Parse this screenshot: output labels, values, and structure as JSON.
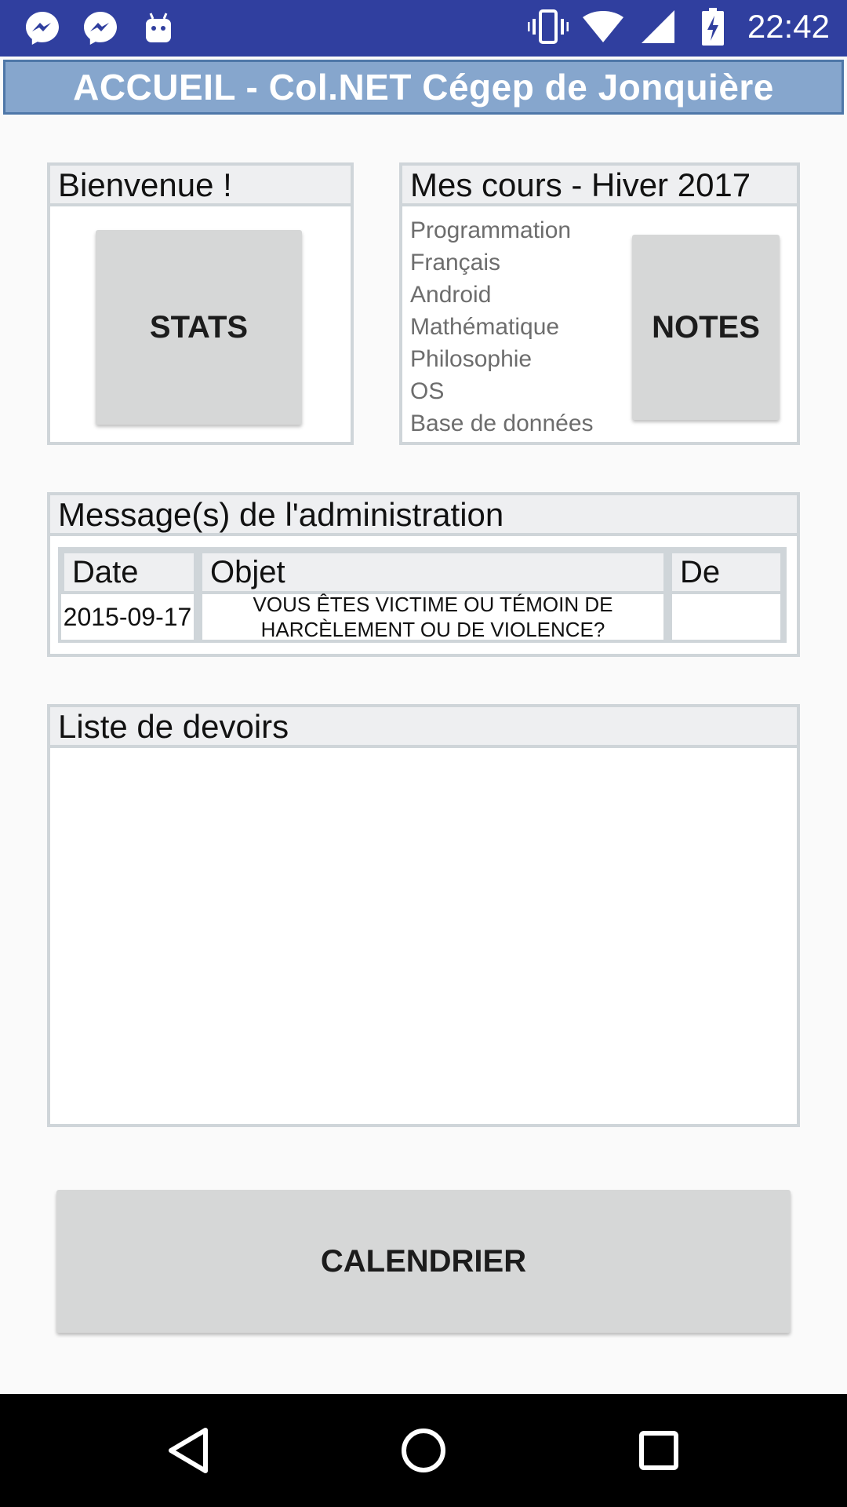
{
  "status_bar": {
    "time": "22:42",
    "left_icons": [
      "messenger-icon",
      "messenger-icon",
      "android-debug-icon"
    ],
    "right_icons": [
      "vibrate-icon",
      "wifi-icon",
      "cell-signal-icon",
      "battery-charging-icon"
    ],
    "color": "#303f9f"
  },
  "title_bar": {
    "title": "ACCUEIL - Col.NET Cégep de Jonquière",
    "color": "#86a6cd"
  },
  "welcome_panel": {
    "header": "Bienvenue !",
    "button_label": "STATS"
  },
  "courses_panel": {
    "header": "Mes cours - Hiver 2017",
    "courses": [
      "Programmation",
      "Français",
      "Android",
      "Mathématique",
      "Philosophie",
      "OS",
      "Base de données"
    ],
    "button_label": "NOTES"
  },
  "messages_panel": {
    "header": "Message(s) de l'administration",
    "columns": [
      "Date",
      "Objet",
      "De"
    ],
    "rows": [
      {
        "date": "2015-09-17",
        "object": "VOUS ÊTES VICTIME OU TÉMOIN DE HARCÈLEMENT OU DE VIOLENCE?",
        "from": ""
      }
    ]
  },
  "homework_panel": {
    "header": "Liste de devoirs"
  },
  "calendar_button": {
    "label": "CALENDRIER"
  },
  "nav_bar": {
    "buttons": [
      "back-icon",
      "home-icon",
      "recents-icon"
    ]
  }
}
